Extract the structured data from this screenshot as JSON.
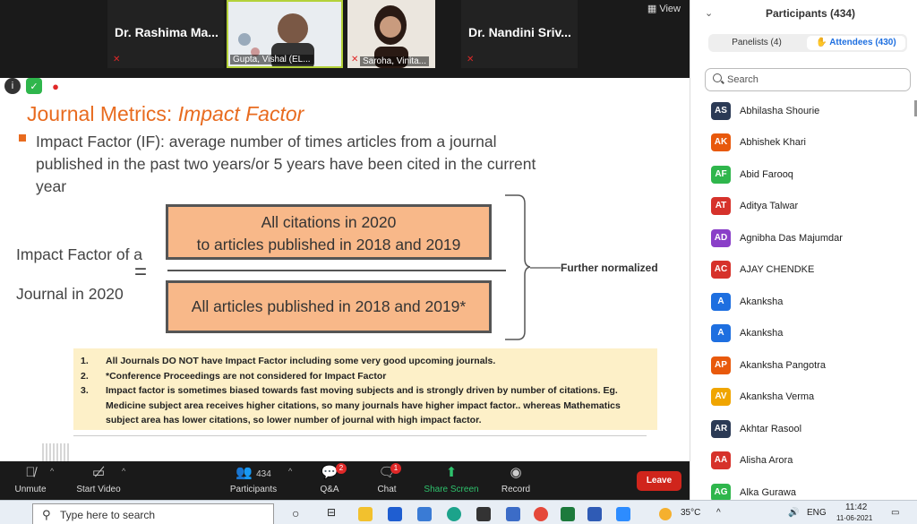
{
  "video": {
    "tiles": [
      {
        "name": "Dr. Rashima Ma..."
      },
      {
        "label": "Gupta, Vishal (EL..."
      },
      {
        "label": "Saroha, Vinita..."
      },
      {
        "name": "Dr. Nandini Sriv..."
      }
    ],
    "view_label": "View"
  },
  "slide": {
    "title_plain": "Journal Metrics: ",
    "title_italic": "Impact Factor",
    "bullet": "Impact Factor (IF): average number of times articles from a journal published in the past two years/or 5 years have been cited in the current year",
    "left_line1": "Impact Factor of a",
    "left_line2": "Journal in 2020",
    "equals": "=",
    "numerator_line1": "All citations in 2020",
    "numerator_line2": "to articles published in 2018 and 2019",
    "denominator": "All articles published in 2018 and 2019*",
    "further": "Further normalized",
    "notes": [
      {
        "num": "1.",
        "text": "All Journals DO NOT have Impact Factor including some very good upcoming journals."
      },
      {
        "num": "2.",
        "text": "*Conference Proceedings are not considered for Impact Factor"
      },
      {
        "num": "3.",
        "text": "Impact factor is sometimes biased towards fast moving subjects and is strongly driven by number of citations. Eg. Medicine subject area receives higher citations, so many journals have higher impact factor.. whereas Mathematics subject area has lower citations, so lower number of journal with high impact factor."
      }
    ]
  },
  "participants": {
    "title": "Participants (434)",
    "panelists": "Panelists (4)",
    "attendees": "Attendees (430)",
    "search_placeholder": "Search",
    "list": [
      {
        "initials": "AS",
        "name": "Abhilasha Shourie",
        "color": "#2b3a55"
      },
      {
        "initials": "AK",
        "name": "Abhishek Khari",
        "color": "#e8590c"
      },
      {
        "initials": "AF",
        "name": "Abid Farooq",
        "color": "#2fb64c"
      },
      {
        "initials": "AT",
        "name": "Aditya Talwar",
        "color": "#d6322b"
      },
      {
        "initials": "AD",
        "name": "Agnibha Das Majumdar",
        "color": "#8a3fc8"
      },
      {
        "initials": "AC",
        "name": "AJAY CHENDKE",
        "color": "#d6322b"
      },
      {
        "initials": "A",
        "name": "Akanksha",
        "color": "#1e6fe0"
      },
      {
        "initials": "A",
        "name": "Akanksha",
        "color": "#1e6fe0"
      },
      {
        "initials": "AP",
        "name": "Akanksha Pangotra",
        "color": "#e8590c"
      },
      {
        "initials": "AV",
        "name": "Akanksha Verma",
        "color": "#f0a500"
      },
      {
        "initials": "AR",
        "name": "Akhtar Rasool",
        "color": "#2b3a55"
      },
      {
        "initials": "AA",
        "name": "Alisha Arora",
        "color": "#d6322b"
      },
      {
        "initials": "AG",
        "name": "Alka Gurawa",
        "color": "#2fb64c"
      }
    ]
  },
  "controls": {
    "unmute": "Unmute",
    "start_video": "Start Video",
    "participants": "Participants",
    "participants_count": "434",
    "qa": "Q&A",
    "qa_badge": "2",
    "chat": "Chat",
    "chat_badge": "1",
    "share": "Share Screen",
    "record": "Record",
    "leave": "Leave"
  },
  "taskbar": {
    "search_placeholder": "Type here to search",
    "temperature": "35°C",
    "lang": "ENG",
    "time": "11:42",
    "date": "11-06-2021"
  }
}
